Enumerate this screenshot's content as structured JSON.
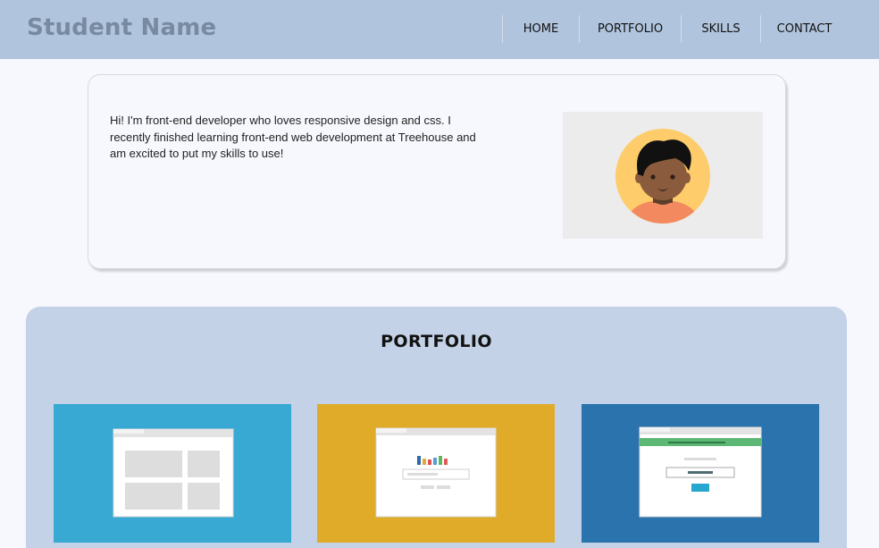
{
  "header": {
    "brand": "Student Name",
    "nav": [
      {
        "label": "HOME"
      },
      {
        "label": "PORTFOLIO"
      },
      {
        "label": "SKILLS"
      },
      {
        "label": "CONTACT"
      }
    ],
    "background_color": "#b0c4de"
  },
  "intro": {
    "text": "Hi! I'm front-end developer who loves responsive design and css. I recently finished learning front-end web development at Treehouse and am excited to put my skills to use!",
    "avatar_icon": "student-avatar-icon"
  },
  "portfolio": {
    "title": "PORTFOLIO",
    "projects": [
      {
        "icon": "grid-layout-wireframe-icon",
        "color": "#37a9d2"
      },
      {
        "icon": "bar-chart-search-wireframe-icon",
        "color": "#e0ab28"
      },
      {
        "icon": "login-form-wireframe-icon",
        "color": "#2b73ac"
      }
    ]
  },
  "colors": {
    "page_background": "#f6f8fd",
    "portfolio_background": "#c3d2e6",
    "brand_text": "#7889a0"
  }
}
